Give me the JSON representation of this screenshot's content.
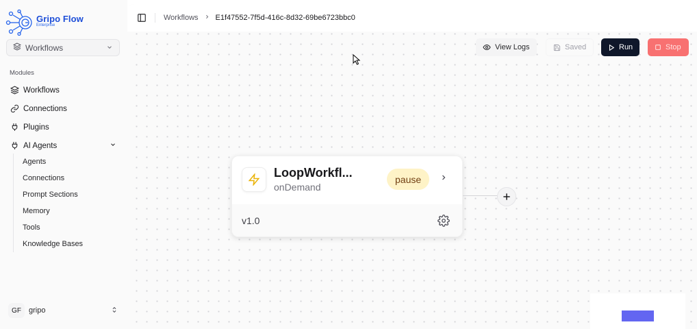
{
  "brand": {
    "name": "Gripo Flow",
    "edition": "Enterprise",
    "color": "#1d4ed8"
  },
  "workspace_select": {
    "label": "Workflows",
    "icon": "layers-icon"
  },
  "sidebar": {
    "section_label": "Modules",
    "items": [
      {
        "label": "Workflows",
        "icon": "layers-icon"
      },
      {
        "label": "Connections",
        "icon": "link-icon"
      },
      {
        "label": "Plugins",
        "icon": "plug-icon"
      },
      {
        "label": "AI Agents",
        "icon": "plug-icon",
        "expanded": true
      }
    ],
    "ai_agents_children": [
      "Agents",
      "Connections",
      "Prompt Sections",
      "Memory",
      "Tools",
      "Knowledge Bases"
    ]
  },
  "user": {
    "initials": "GF",
    "name": "gripo"
  },
  "breadcrumb": {
    "root": "Workflows",
    "current": "E1f47552-7f5d-416c-8d32-69be6723bbc0"
  },
  "toolbar": {
    "view_logs": "View Logs",
    "saved": "Saved",
    "run": "Run",
    "stop": "Stop"
  },
  "node": {
    "title": "LoopWorkfl...",
    "trigger": "onDemand",
    "status": "pause",
    "version": "v1.0",
    "icon": "lightning-icon",
    "icon_color": "#eab308"
  },
  "colors": {
    "run_bg": "#0f172a",
    "stop_bg": "#f87171",
    "badge_bg": "#fef3c7",
    "minimap_node": "#6366f1"
  }
}
